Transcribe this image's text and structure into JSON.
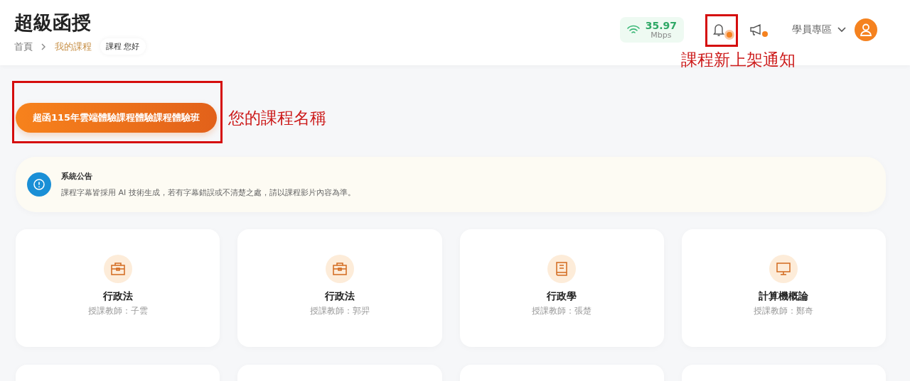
{
  "header": {
    "title": "超級函授",
    "breadcrumb": [
      {
        "label": "首頁",
        "selected": false
      },
      {
        "label": "我的課程",
        "selected": true
      }
    ],
    "greeting": "課程 您好",
    "speed": {
      "value": "35.97",
      "unit": "Mbps"
    },
    "notifications": {
      "unread": true,
      "annotation": "課程新上架通知"
    },
    "announcements": {
      "unread": true
    },
    "user_menu": "學員專區"
  },
  "course_button": {
    "label": "超函115年雲端體驗課程體驗課程體驗班",
    "annotation": "您的課程名稱"
  },
  "notice": {
    "title": "系統公告",
    "text": "課程字幕皆採用 AI 技術生成，若有字幕錯誤或不清楚之處，請以課程影片內容為準。"
  },
  "courses": [
    {
      "kind": "briefcase",
      "name": "行政法",
      "teacher": "授課教師：子雲"
    },
    {
      "kind": "briefcase",
      "name": "行政法",
      "teacher": "授課教師：郭羿"
    },
    {
      "kind": "book",
      "name": "行政學",
      "teacher": "授課教師：張楚"
    },
    {
      "kind": "monitor",
      "name": "計算機概論",
      "teacher": "授課教師：鄭奇"
    }
  ]
}
